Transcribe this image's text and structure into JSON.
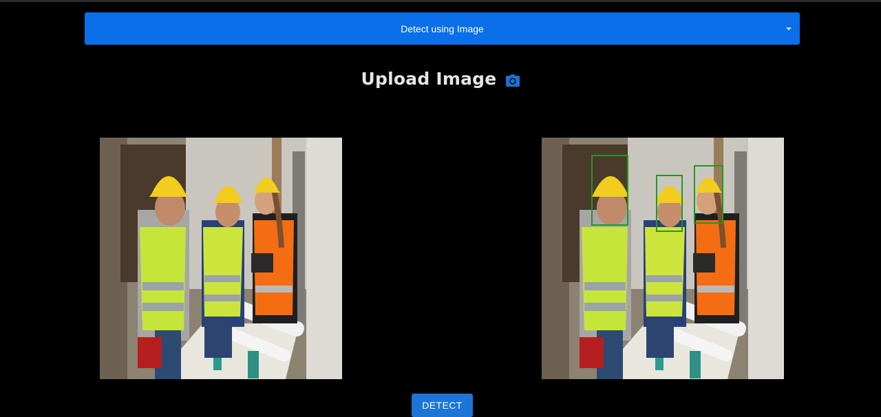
{
  "detection_mode": {
    "selected": "Detect using Image"
  },
  "upload": {
    "title": "Upload Image",
    "icon": "camera-icon"
  },
  "images": {
    "input_label": "uploaded-image",
    "output_label": "detection-result-image",
    "detections_count": 3
  },
  "actions": {
    "detect_label": "DETECT"
  },
  "colors": {
    "accent": "#0a6fe8",
    "button": "#1d75d8",
    "box": "#1f9a1f",
    "background": "#000000"
  }
}
